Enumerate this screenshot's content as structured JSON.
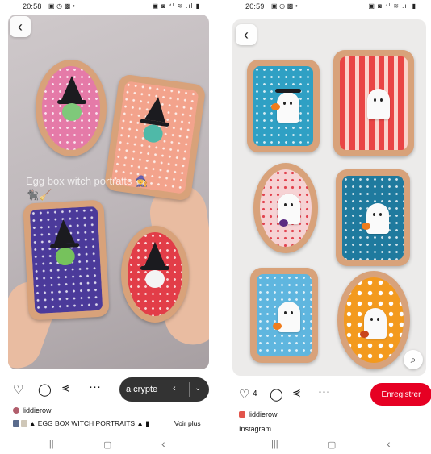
{
  "left": {
    "status": {
      "time": "20:58",
      "left_icons": "▣ ◷ ▩ •",
      "right_icons": "▣ ◙ ⁴ᴵ ≋ .ıl ▮"
    },
    "overlay_text": "Egg box witch portraits 🧙‍♀️🐈‍⬛🧹",
    "pill_text": "a crypte",
    "author": "liddierowl",
    "description": "EGG BOX WITCH PORTRAITS",
    "see_more": "Voir plus",
    "icons": {
      "back": "chevron-left-icon",
      "like": "heart-icon",
      "comment": "comment-icon",
      "share": "share-icon",
      "more": "more-icon"
    }
  },
  "right": {
    "status": {
      "time": "20:59",
      "left_icons": "▣ ◷ ▩ •",
      "right_icons": "▣ ◙ ⁴ᴵ ≋ .ıl ▮"
    },
    "like_count": "4",
    "save_label": "Enregistrer",
    "author": "liddierowl",
    "source": "Instagram",
    "icons": {
      "back": "chevron-left-icon",
      "lens": "visual-search-icon",
      "like": "heart-icon",
      "comment": "comment-icon",
      "share": "share-icon",
      "more": "more-icon"
    }
  },
  "navbar": {
    "recents": "|||",
    "home": "▢",
    "back": "‹"
  },
  "colors": {
    "save_red": "#e60023",
    "pill_dark": "#333333",
    "frame_tan": "#d8a27a"
  }
}
